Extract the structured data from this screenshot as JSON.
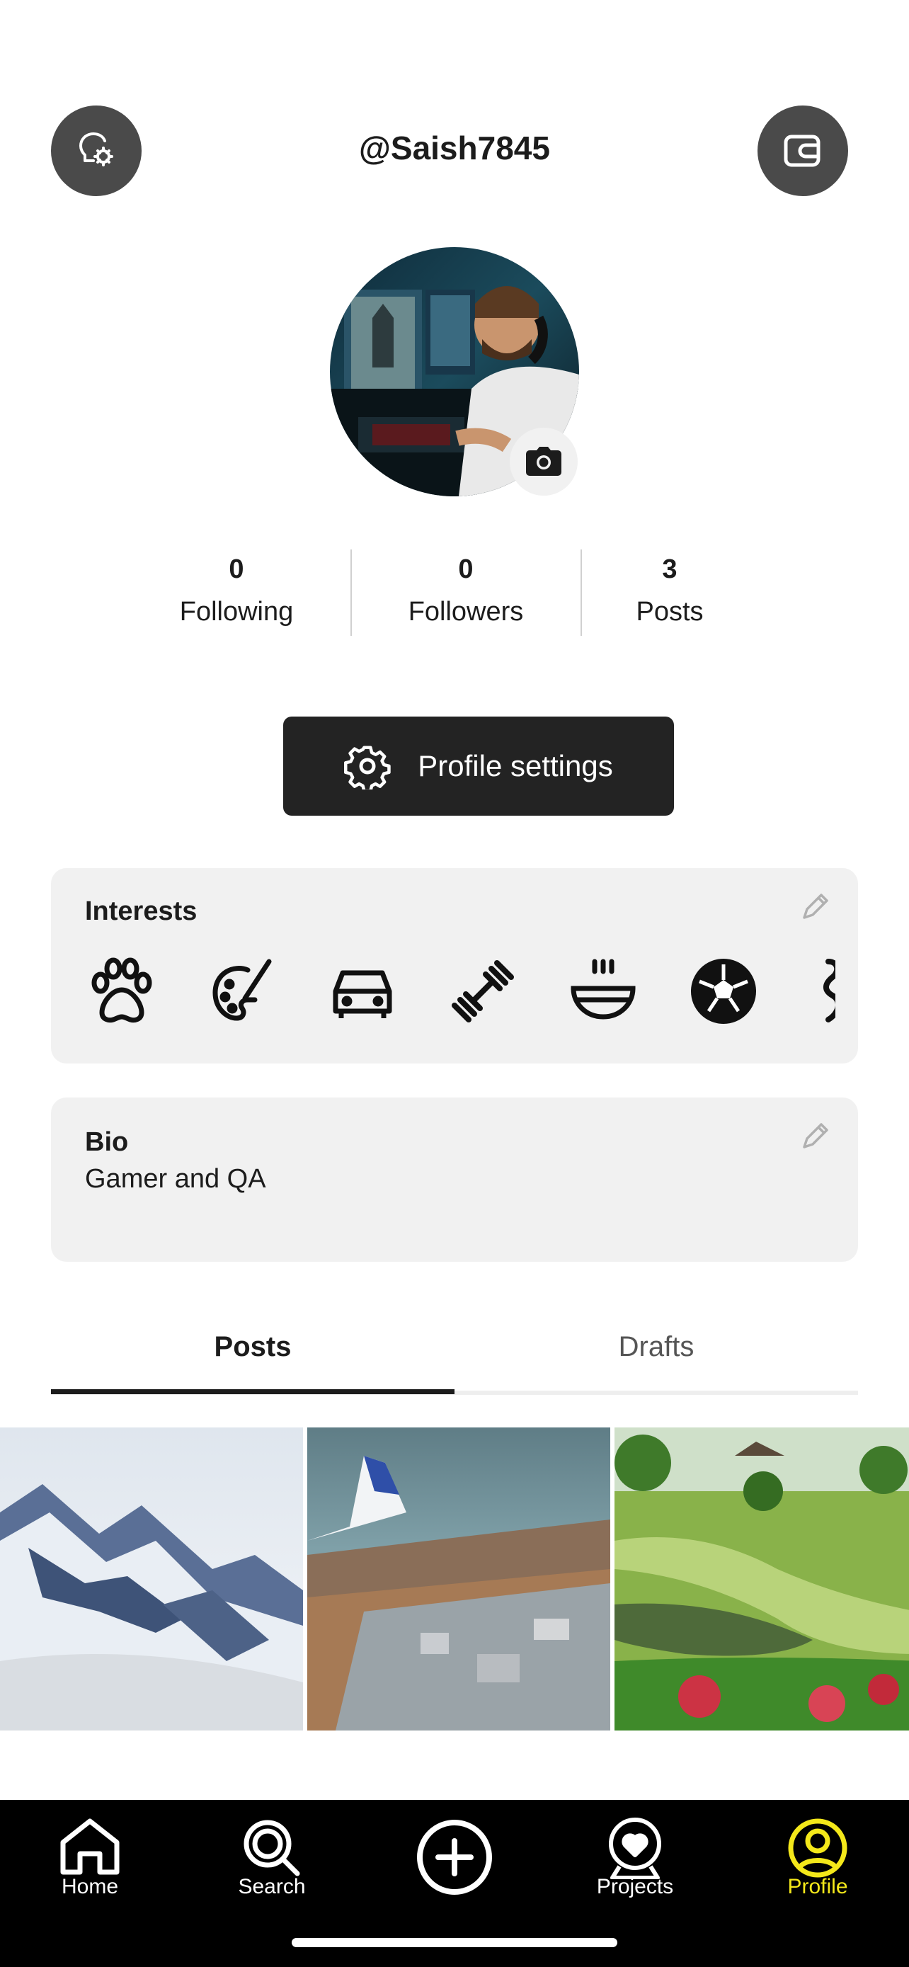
{
  "header": {
    "username": "@Saish7845",
    "left_button_icon": "bulb-gear-icon",
    "right_button_icon": "wallet-icon"
  },
  "stats": [
    {
      "value": "0",
      "label": "Following"
    },
    {
      "value": "0",
      "label": "Followers"
    },
    {
      "value": "3",
      "label": "Posts"
    }
  ],
  "settings_button": {
    "label": "Profile settings",
    "icon": "gear-icon"
  },
  "interests": {
    "title": "Interests",
    "icons": [
      "paw-icon",
      "palette-icon",
      "car-icon",
      "dumbbell-icon",
      "bowl-icon",
      "soccer-ball-icon",
      "dance-icon"
    ]
  },
  "bio": {
    "title": "Bio",
    "text": "Gamer and QA"
  },
  "tabs": [
    {
      "label": "Posts",
      "active": true
    },
    {
      "label": "Drafts",
      "active": false
    }
  ],
  "posts": [
    "mountain-photo",
    "airplane-wing-city-photo",
    "park-pond-photo"
  ],
  "bottom_nav": [
    {
      "label": "Home",
      "icon": "home-icon",
      "active": false
    },
    {
      "label": "Search",
      "icon": "search-icon",
      "active": false
    },
    {
      "label": "",
      "icon": "add-icon",
      "active": false
    },
    {
      "label": "Projects",
      "icon": "projects-icon",
      "active": false
    },
    {
      "label": "Profile",
      "icon": "profile-icon",
      "active": true
    }
  ],
  "colors": {
    "accent": "#f4e81a",
    "dark_button": "#232323",
    "card_bg": "#f1f1f1",
    "header_button_bg": "#4a4a4a"
  }
}
